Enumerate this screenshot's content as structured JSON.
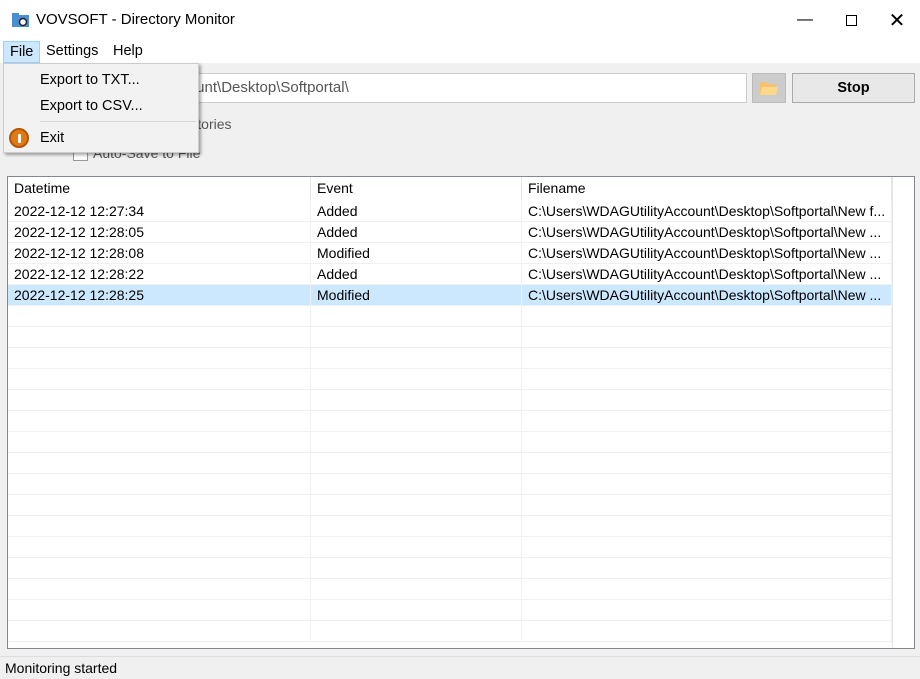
{
  "window": {
    "title": "VOVSOFT - Directory Monitor",
    "icons": {
      "app": "folder-magnifier-icon",
      "minimize": "minimize-icon",
      "maximize": "maximize-icon",
      "close": "close-icon"
    }
  },
  "menubar": {
    "items": [
      {
        "label": "File",
        "active": true
      },
      {
        "label": "Settings"
      },
      {
        "label": "Help"
      }
    ]
  },
  "file_menu": {
    "items": [
      {
        "label": "Export to TXT..."
      },
      {
        "label": "Export to CSV..."
      },
      {
        "label": "Exit",
        "icon": "power-icon"
      }
    ]
  },
  "toolbar": {
    "path_value": "C:\\Users\\WDAGUtilityAccount\\Desktop\\Softportal\\",
    "browse_icon": "folder-open-icon",
    "stop_label": "Stop"
  },
  "options": {
    "include_subdirs_label": "Include Subdirectories",
    "include_subdirs_checked": false,
    "autosave_label": "Auto-Save to File",
    "autosave_checked": false
  },
  "table": {
    "columns": [
      "Datetime",
      "Event",
      "Filename"
    ],
    "rows": [
      {
        "datetime": "2022-12-12 12:27:34",
        "event": "Added",
        "filename": "C:\\Users\\WDAGUtilityAccount\\Desktop\\Softportal\\New f..."
      },
      {
        "datetime": "2022-12-12 12:28:05",
        "event": "Added",
        "filename": "C:\\Users\\WDAGUtilityAccount\\Desktop\\Softportal\\New ..."
      },
      {
        "datetime": "2022-12-12 12:28:08",
        "event": "Modified",
        "filename": "C:\\Users\\WDAGUtilityAccount\\Desktop\\Softportal\\New ..."
      },
      {
        "datetime": "2022-12-12 12:28:22",
        "event": "Added",
        "filename": "C:\\Users\\WDAGUtilityAccount\\Desktop\\Softportal\\New ..."
      },
      {
        "datetime": "2022-12-12 12:28:25",
        "event": "Modified",
        "filename": "C:\\Users\\WDAGUtilityAccount\\Desktop\\Softportal\\New ...",
        "selected": true
      }
    ]
  },
  "status": {
    "text": "Monitoring started"
  },
  "colors": {
    "selection": "#cce8ff",
    "accent_menu": "#99d1ff",
    "exit_icon": "#e07a10"
  }
}
